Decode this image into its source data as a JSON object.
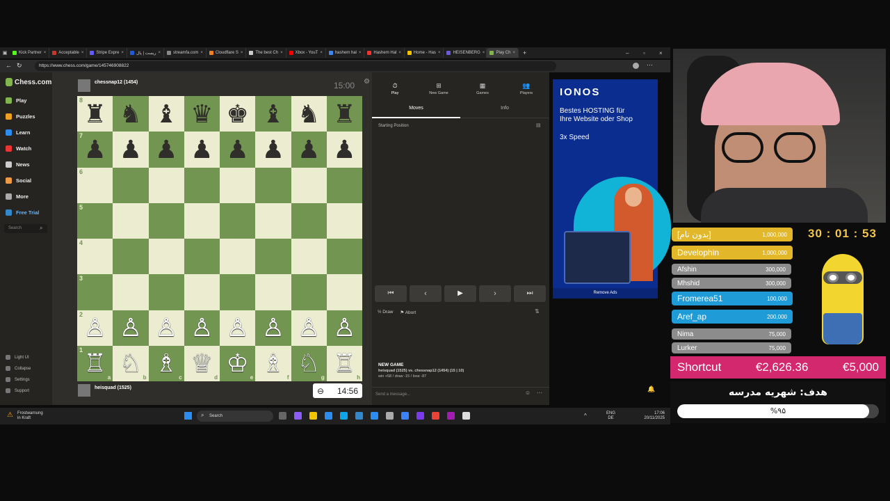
{
  "browser": {
    "tabs": [
      {
        "label": "Kick Partner",
        "color": "#53fc18"
      },
      {
        "label": "Acceptable",
        "color": "#c0392b"
      },
      {
        "label": "Stripe Expre",
        "color": "#635bff"
      },
      {
        "label": "ریست | پال",
        "color": "#1f5bd8"
      },
      {
        "label": "streamfa.com",
        "color": "#888888"
      },
      {
        "label": "Cloudflare S",
        "color": "#f38020"
      },
      {
        "label": "The best Ch",
        "color": "#cccccc"
      },
      {
        "label": "Xbox - YouT",
        "color": "#ff0000"
      },
      {
        "label": "hashem hal",
        "color": "#4285f4"
      },
      {
        "label": "Hashem Hal",
        "color": "#e33"
      },
      {
        "label": "Home - Has",
        "color": "#f5c400"
      },
      {
        "label": "HEISENBERG",
        "color": "#6b5bd6"
      },
      {
        "label": "Play Ch",
        "color": "#81b64c"
      }
    ],
    "url": "https://www.chess.com/game/145746908822"
  },
  "chess_nav": {
    "logo": "Chess.com",
    "items": [
      "Play",
      "Puzzles",
      "Learn",
      "Watch",
      "News",
      "Social",
      "More",
      "Free Trial"
    ],
    "search_placeholder": "Search",
    "bottom": [
      "Light UI",
      "Collapse",
      "Settings",
      "Support"
    ]
  },
  "game": {
    "top_player": "chessnap12 (1454)",
    "top_clock": "15:00",
    "bottom_player": "heisquad (1525)",
    "bottom_clock": "14:56",
    "board": [
      [
        "♜",
        "♞",
        "♝",
        "♛",
        "♚",
        "♝",
        "♞",
        "♜"
      ],
      [
        "♟",
        "♟",
        "♟",
        "♟",
        "♟",
        "♟",
        "♟",
        "♟"
      ],
      [
        "",
        "",
        "",
        "",
        "",
        "",
        "",
        ""
      ],
      [
        "",
        "",
        "",
        "",
        "",
        "",
        "",
        ""
      ],
      [
        "",
        "",
        "",
        "",
        "",
        "",
        "",
        ""
      ],
      [
        "",
        "",
        "",
        "",
        "",
        "",
        "",
        ""
      ],
      [
        "♙",
        "♙",
        "♙",
        "♙",
        "♙",
        "♙",
        "♙",
        "♙"
      ],
      [
        "♖",
        "♘",
        "♗",
        "♕",
        "♔",
        "♗",
        "♘",
        "♖"
      ]
    ],
    "ranks": [
      "8",
      "7",
      "6",
      "5",
      "4",
      "3",
      "2",
      "1"
    ],
    "files": [
      "a",
      "b",
      "c",
      "d",
      "e",
      "f",
      "g",
      "h"
    ]
  },
  "panel": {
    "top_buttons": [
      "Play",
      "New Game",
      "Games",
      "Players"
    ],
    "tabs": [
      "Moves",
      "Info"
    ],
    "starting": "Starting Position",
    "draw": "Draw",
    "abort": "Abort",
    "new_game_title": "NEW GAME",
    "new_game_line1": "heisquad (1525) vs. chessnap12 (1454) (15 | 10)",
    "new_game_line2": "win +58 / draw -15 / lose -87",
    "message_placeholder": "Send a message..."
  },
  "ad": {
    "brand": "IONOS",
    "line1": "Bestes HOSTING für",
    "line2": "Ihre Website oder Shop",
    "speed": "3x Speed",
    "remove": "Remove Ads"
  },
  "taskbar": {
    "weather1": "Frostwarnung",
    "weather2": "in Kraft",
    "search": "Search",
    "lang1": "ENG",
    "lang2": "DE",
    "time": "17:06",
    "date": "20/11/2025"
  },
  "overlay": {
    "timer": "30 : 01 : 53",
    "donors": [
      {
        "name": "[بدون نام]",
        "amount": "1,000,000",
        "color": "#e2b82a"
      },
      {
        "name": "Develophin",
        "amount": "1,000,000",
        "color": "#e2b82a"
      },
      {
        "name": "Afshin",
        "amount": "300,000",
        "color": "#8c8c8c"
      },
      {
        "name": "Mhshid",
        "amount": "300,000",
        "color": "#8c8c8c"
      },
      {
        "name": "Fromerea51",
        "amount": "100,000",
        "color": "#1f9bd8"
      },
      {
        "name": "Aref_ap",
        "amount": "200,000",
        "color": "#1f9bd8"
      },
      {
        "name": "Nima",
        "amount": "75,000",
        "color": "#8c8c8c"
      },
      {
        "name": "Lurker",
        "amount": "75,000",
        "color": "#8c8c8c"
      }
    ],
    "shortcut_label": "Shortcut",
    "shortcut_value": "€2,626.36",
    "shortcut_goal": "€5,000",
    "goal_title": "هدف: شهریه مدرسه",
    "goal_percent": "%۹۵",
    "goal_progress": 0.95
  },
  "colors": {
    "board_light": "#ebecd0",
    "board_dark": "#739552",
    "shortcut_bg": "#d3276e"
  }
}
